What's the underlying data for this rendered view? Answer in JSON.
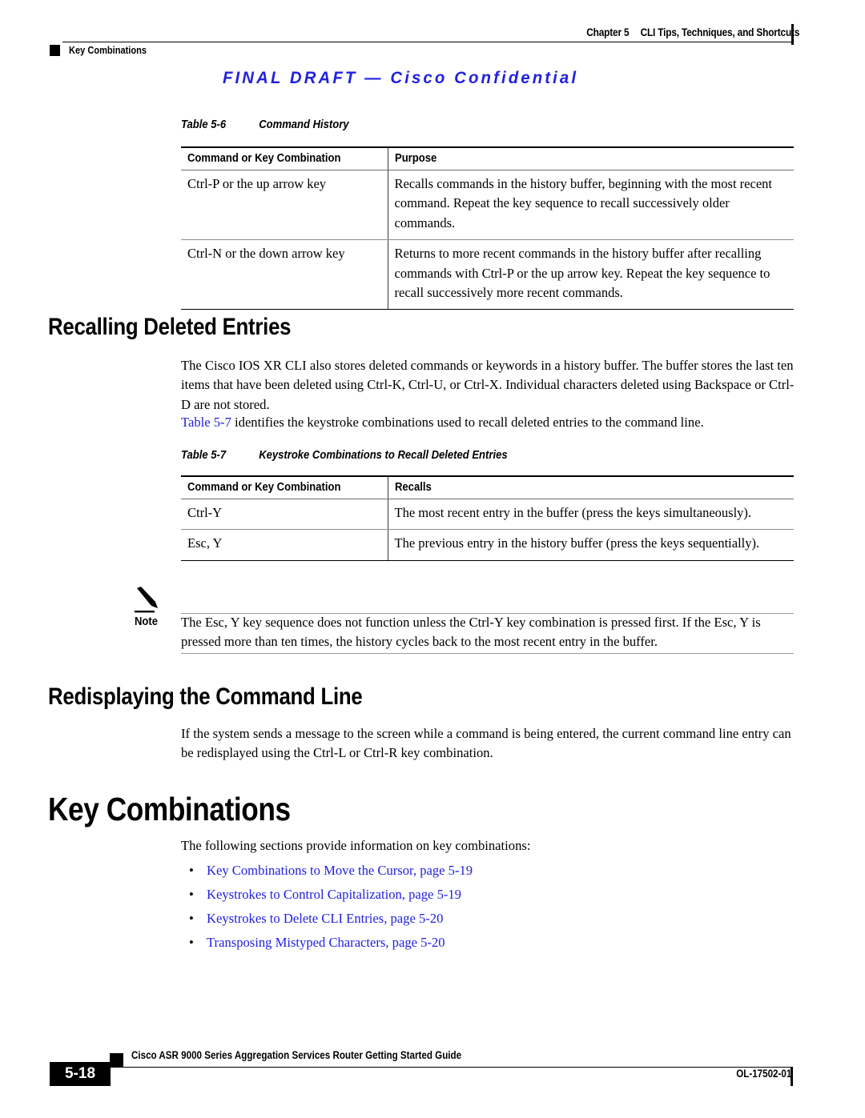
{
  "header": {
    "chapter": "Chapter 5",
    "chapter_title": "CLI Tips, Techniques, and Shortcuts",
    "section_marker": "Key Combinations",
    "draft_watermark": "FINAL DRAFT — Cisco Confidential",
    "watermark_color": "#2121e0"
  },
  "table_5_6": {
    "caption_number": "Table 5-6",
    "caption_title": "Command History",
    "columns": [
      "Command or Key Combination",
      "Purpose"
    ],
    "rows": [
      {
        "command": "Ctrl-P or the up arrow key",
        "purpose": "Recalls commands in the history buffer, beginning with the most recent command. Repeat the key sequence to recall successively older commands."
      },
      {
        "command": "Ctrl-N or the down arrow key",
        "purpose": "Returns to more recent commands in the history buffer after recalling commands with Ctrl-P or the up arrow key. Repeat the key sequence to recall successively more recent commands."
      }
    ]
  },
  "section_recalling": {
    "heading": "Recalling Deleted Entries",
    "para1": "The Cisco IOS XR CLI also stores deleted commands or keywords in a history buffer. The buffer stores the last ten items that have been deleted using Ctrl-K, Ctrl-U, or Ctrl-X. Individual characters deleted using Backspace or Ctrl-D are not stored.",
    "para2_link": "Table 5-7",
    "para2_rest": " identifies the keystroke combinations used to recall deleted entries to the command line."
  },
  "table_5_7": {
    "caption_number": "Table 5-7",
    "caption_title": "Keystroke Combinations to Recall Deleted Entries",
    "columns": [
      "Command or Key Combination",
      "Recalls"
    ],
    "rows": [
      {
        "command": "Ctrl-Y",
        "recalls": "The most recent entry in the buffer (press the keys simultaneously)."
      },
      {
        "command": "Esc, Y",
        "recalls": "The previous entry in the history buffer (press the keys sequentially)."
      }
    ]
  },
  "note": {
    "label": "Note",
    "icon": "pencil-icon",
    "text": "The Esc, Y key sequence does not function unless the Ctrl-Y key combination is pressed first. If the Esc, Y is pressed more than ten times, the history cycles back to the most recent entry in the buffer."
  },
  "section_redisplay": {
    "heading": "Redisplaying the Command Line",
    "para": "If the system sends a message to the screen while a command is being entered, the current command line entry can be redisplayed using the Ctrl-L or Ctrl-R key combination."
  },
  "section_key_combinations": {
    "heading": "Key Combinations",
    "intro": "The following sections provide information on key combinations:",
    "bullet_glyph": "•",
    "link_color": "#2121e0",
    "links": [
      "Key Combinations to Move the Cursor, page 5-19",
      "Keystrokes to Control Capitalization, page 5-19",
      "Keystrokes to Delete CLI Entries, page 5-20",
      "Transposing Mistyped Characters, page 5-20"
    ]
  },
  "footer": {
    "doc_title": "Cisco ASR 9000 Series Aggregation Services Router Getting Started Guide",
    "page_number": "5-18",
    "doc_id": "OL-17502-01"
  }
}
